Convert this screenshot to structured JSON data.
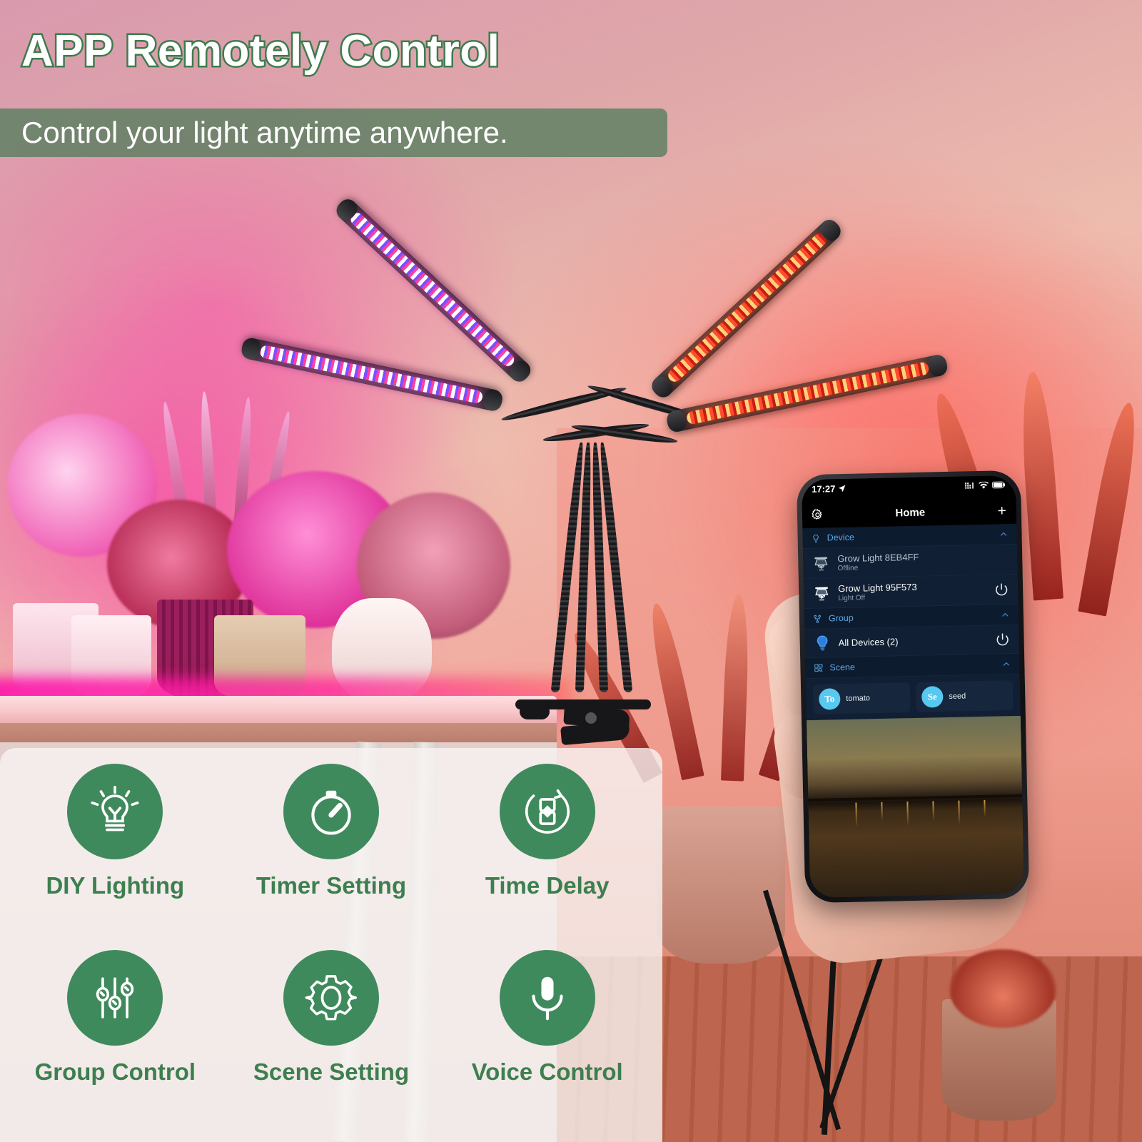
{
  "header": {
    "title": "APP Remotely Control",
    "subtitle": "Control your light anytime anywhere."
  },
  "colors": {
    "brand_green": "#3f8a5c",
    "label_green": "#3d7f4f",
    "title_outline": "#3d7c4c",
    "subtitle_bar": "#587e5f",
    "app_accent_blue": "#5aa8e8",
    "scene_avatar_blue": "#57c8ef"
  },
  "features": [
    {
      "label": "DIY Lighting",
      "icon": "lightbulb-icon"
    },
    {
      "label": "Timer Setting",
      "icon": "stopwatch-icon"
    },
    {
      "label": "Time Delay",
      "icon": "hourglass-icon"
    },
    {
      "label": "Group Control",
      "icon": "sliders-icon"
    },
    {
      "label": "Scene Setting",
      "icon": "gear-icon"
    },
    {
      "label": "Voice Control",
      "icon": "microphone-icon"
    }
  ],
  "phone": {
    "status_bar": {
      "time": "17:27",
      "location_icon": "location-arrow-icon",
      "signal_icon": "signal-dots-icon",
      "wifi_icon": "wifi-icon",
      "battery_icon": "battery-icon"
    },
    "nav": {
      "settings_icon": "gear-icon",
      "title": "Home",
      "add_label": "+"
    },
    "sections": [
      {
        "name": "Device",
        "icon": "bulb-outline-icon",
        "collapse_icon": "chevron-up-icon",
        "rows": [
          {
            "name": "Grow Light 8EB4FF",
            "status": "Offline",
            "icon": "grow-light-icon",
            "power": false
          },
          {
            "name": "Grow Light 95F573",
            "status": "Light Off",
            "icon": "grow-light-icon",
            "power": true
          }
        ]
      },
      {
        "name": "Group",
        "icon": "group-nodes-icon",
        "collapse_icon": "chevron-up-icon",
        "rows": [
          {
            "name": "All Devices (2)",
            "status": "",
            "icon": "blue-bulb-icon",
            "power": true
          }
        ]
      },
      {
        "name": "Scene",
        "icon": "scene-grid-icon",
        "collapse_icon": "chevron-up-icon",
        "scenes": [
          {
            "abbr": "To",
            "name": "tomato"
          },
          {
            "abbr": "Se",
            "name": "seed"
          }
        ]
      }
    ]
  },
  "product": {
    "heads": [
      {
        "color": "violet-white"
      },
      {
        "color": "violet-white"
      },
      {
        "color": "red-orange"
      },
      {
        "color": "red-orange"
      }
    ]
  }
}
